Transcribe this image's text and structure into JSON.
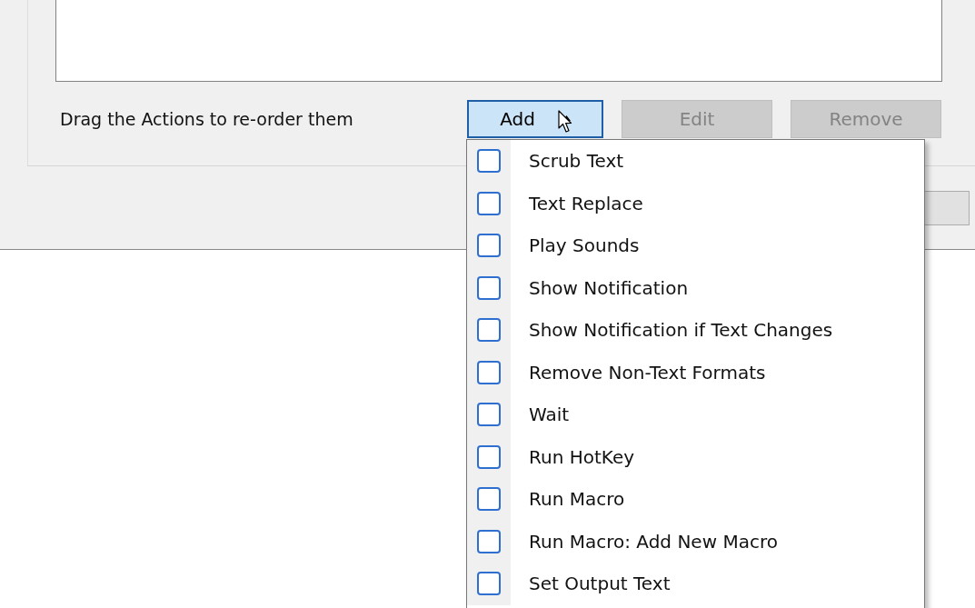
{
  "hint": "Drag the Actions to re-order them",
  "buttons": [
    {
      "label": "Add",
      "kind": "dropdown",
      "disabled": false,
      "pressed": true
    },
    {
      "label": "Edit",
      "kind": "plain",
      "disabled": true,
      "pressed": false
    },
    {
      "label": "Remove",
      "kind": "plain",
      "disabled": true,
      "pressed": false
    }
  ],
  "menu": [
    {
      "label": "Scrub Text",
      "checked": false
    },
    {
      "label": "Text Replace",
      "checked": false
    },
    {
      "label": "Play Sounds",
      "checked": false
    },
    {
      "label": "Show Notification",
      "checked": false
    },
    {
      "label": "Show Notification if Text Changes",
      "checked": false
    },
    {
      "label": "Remove Non-Text Formats",
      "checked": false
    },
    {
      "label": "Wait",
      "checked": false
    },
    {
      "label": "Run HotKey",
      "checked": false
    },
    {
      "label": "Run Macro",
      "checked": false
    },
    {
      "label": "Run Macro: Add New Macro",
      "checked": false
    },
    {
      "label": "Set Output Text",
      "checked": false
    }
  ]
}
